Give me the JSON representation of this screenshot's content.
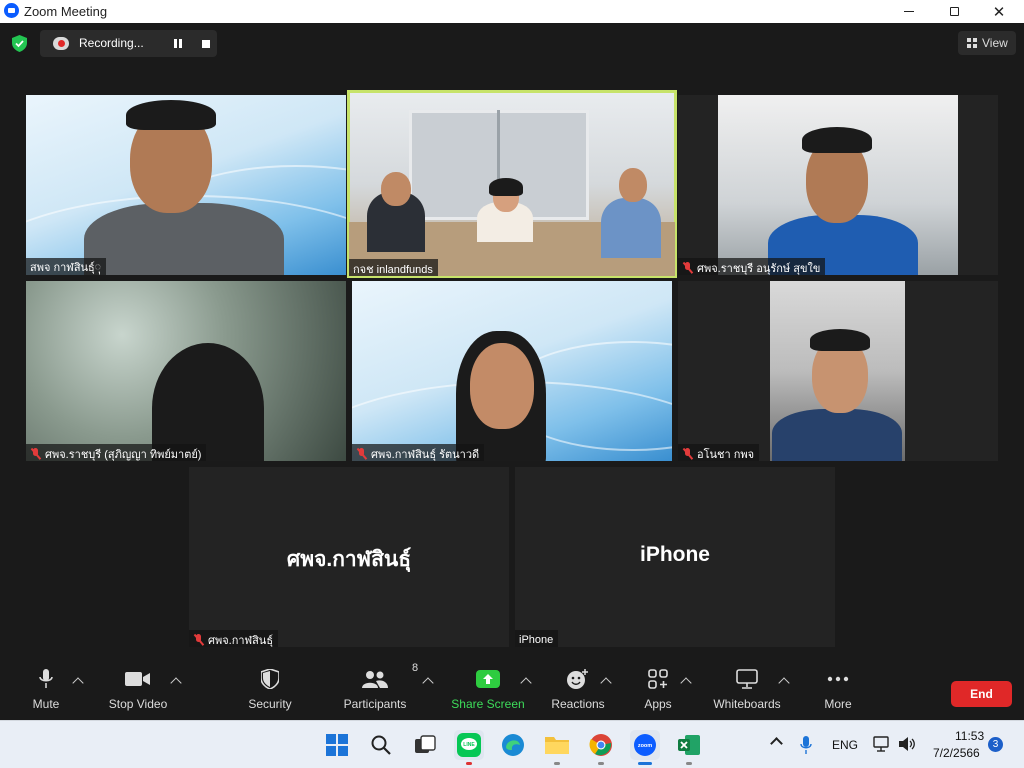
{
  "window": {
    "title": "Zoom Meeting"
  },
  "recording": {
    "label": "Recording..."
  },
  "view_button": {
    "label": "View"
  },
  "tiles": [
    {
      "name": "สพจ กาฬสินธุ์ុ",
      "muted": false
    },
    {
      "name": "กจช inlandfunds",
      "muted": false,
      "active": true
    },
    {
      "name": "ศพจ.ราชบุรี อนุรักษ์ สุขใข",
      "muted": true
    },
    {
      "name": "ศพจ.ราชบุรี (สุภิญญา ทิพย์มาตย์)",
      "muted": true
    },
    {
      "name": "ศพจ.กาฬสินธุ์ รัตนาวดี",
      "muted": true
    },
    {
      "name": "อโนชา กพจ",
      "muted": true
    },
    {
      "name": "ศพจ.กาฬสินธุ์",
      "muted": true,
      "display_name": "ศพจ.กาฬสินธุ์"
    },
    {
      "name": "iPhone",
      "muted": false,
      "display_name": "iPhone"
    }
  ],
  "toolbar": {
    "mute": "Mute",
    "stop_video": "Stop Video",
    "security": "Security",
    "participants": "Participants",
    "participants_count": "8",
    "share_screen": "Share Screen",
    "reactions": "Reactions",
    "apps": "Apps",
    "whiteboards": "Whiteboards",
    "more": "More",
    "end": "End"
  },
  "taskbar": {
    "language": "ENG",
    "time": "11:53",
    "date": "7/2/2566",
    "notification_count": "3"
  },
  "colors": {
    "active_speaker_border": "#c7e36a",
    "share_green": "#2ecc40",
    "end_red": "#e02828",
    "zoom_blue": "#0b5cff"
  }
}
